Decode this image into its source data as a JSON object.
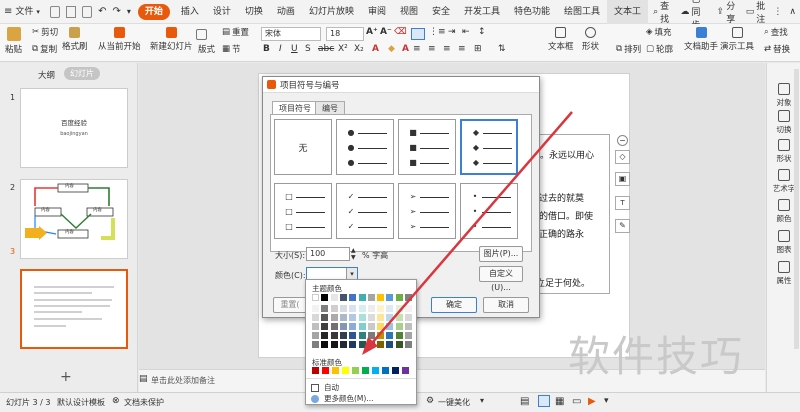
{
  "menubar": {
    "file": "文件",
    "tabs": [
      "开始",
      "插入",
      "设计",
      "切换",
      "动画",
      "幻灯片放映",
      "审阅",
      "视图",
      "安全",
      "开发工具",
      "特色功能",
      "绘图工具",
      "文本工"
    ],
    "active_tab": "开始",
    "search": "查找",
    "cloud": "已同步",
    "share": "分享",
    "comment": "批注"
  },
  "ribbon": {
    "paste": "粘贴",
    "cut": "剪切",
    "copy": "复制",
    "format_painter": "格式刷",
    "from_current": "从当前开始",
    "new_slide": "新建幻灯片",
    "layout": "版式",
    "section": "节",
    "reset": "重置",
    "font_name": "宋体",
    "font_size": "18",
    "textbox": "文本框",
    "shape": "形状",
    "arrange": "排列",
    "fill": "填充",
    "outline": "轮廓",
    "doc_helper": "文档助手",
    "presentation_tools": "演示工具",
    "find": "查找",
    "replace": "替换"
  },
  "leftpanel": {
    "tab_outline": "大纲",
    "tab_slides": "幻灯片",
    "slide1_num": "1",
    "slide1_title": "百度经验",
    "slide1_sub": "baojingyan",
    "slide2_num": "2",
    "slide3_num": "3",
    "diagram_top": "内容",
    "diagram_left": "内容",
    "diagram_right": "内容",
    "diagram_bottom": "内容"
  },
  "slide": {
    "line1": "。永远以用心",
    "line2": "，过去的就莫",
    "line3": "盾的借口。即使",
    "line4": "条正确的路永",
    "line5": "立足于何处。"
  },
  "dialog": {
    "title": "项目符号与编号",
    "tab_bullets": "项目符号",
    "tab_numbering": "编号",
    "none_label": "无",
    "size_label": "大小(S):",
    "size_value": "100",
    "size_unit": "% 字高",
    "color_label": "颜色(C):",
    "picture_btn": "图片(P)...",
    "custom_btn": "自定义(U)...",
    "reset_btn": "重置(",
    "ok_btn": "确定",
    "cancel_btn": "取消"
  },
  "colorpop": {
    "theme_label": "主题颜色",
    "standard_label": "标准颜色",
    "auto_label": "自动",
    "more_label": "更多颜色(M)..."
  },
  "rightbar": {
    "items": [
      "对象",
      "切换",
      "形状",
      "艺术字",
      "颜色",
      "图表",
      "属性"
    ]
  },
  "notes": {
    "placeholder": "单击此处添加备注"
  },
  "status": {
    "slide_count": "幻灯片 3 / 3",
    "template": "默认设计模板",
    "protect": "文档未保护",
    "beautify": "一键美化"
  },
  "watermark": "软件技巧",
  "colors": {
    "accent": "#e8590c",
    "selection_blue": "#3b7fd6",
    "arrow_red": "#d9363e"
  }
}
